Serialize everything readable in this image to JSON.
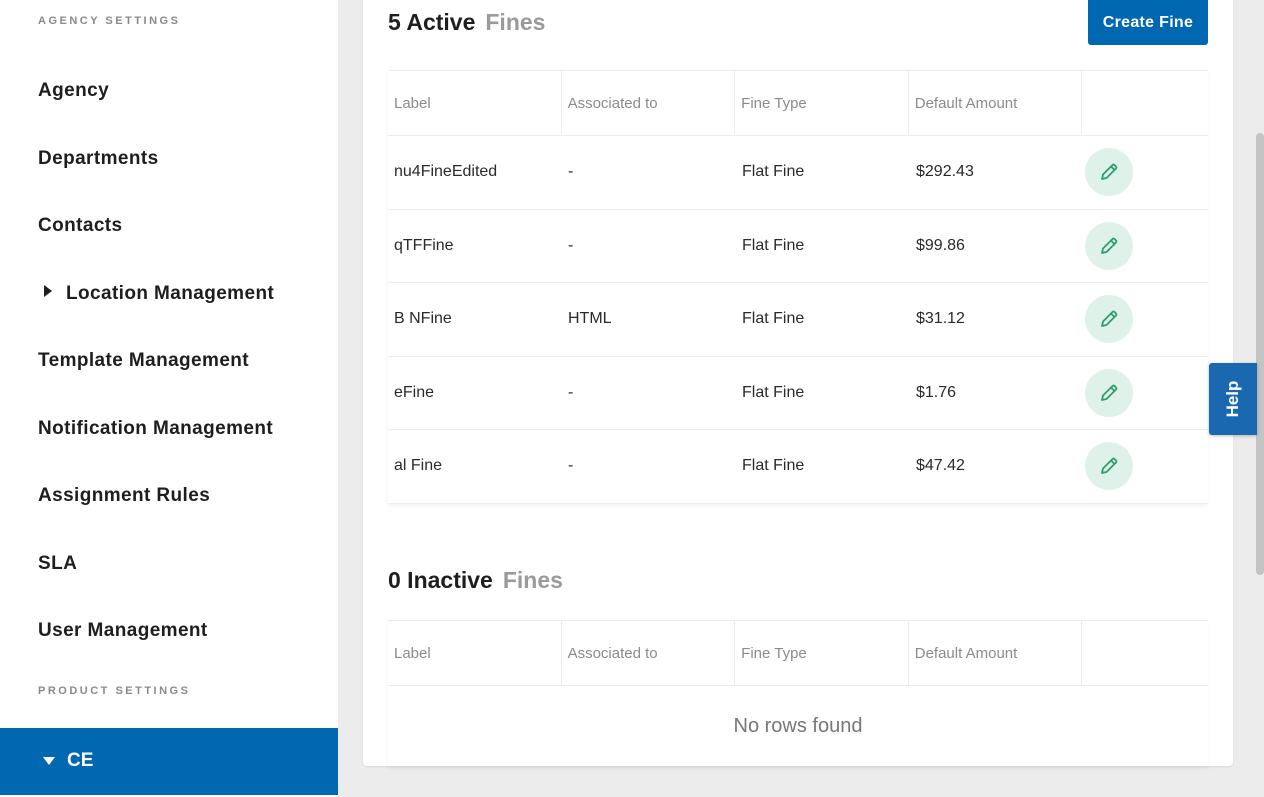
{
  "sidebar": {
    "agency_section_label": "AGENCY SETTINGS",
    "items": [
      {
        "label": "Agency"
      },
      {
        "label": "Departments"
      },
      {
        "label": "Contacts"
      },
      {
        "label": "Location Management",
        "collapsed": true
      },
      {
        "label": "Template Management"
      },
      {
        "label": "Notification Management"
      },
      {
        "label": "Assignment Rules"
      },
      {
        "label": "SLA"
      },
      {
        "label": "User Management"
      }
    ],
    "product_section_label": "PRODUCT SETTINGS",
    "active_item": {
      "label": "CE",
      "expanded": true
    }
  },
  "active": {
    "count": "5 Active",
    "noun": "Fines",
    "create_label": "Create Fine",
    "columns": [
      "Label",
      "Associated to",
      "Fine Type",
      "Default Amount"
    ],
    "rows": [
      {
        "label": "nu4FineEdited",
        "associated": "-",
        "type": "Flat Fine",
        "amount": "$292.43"
      },
      {
        "label": "qTFFine",
        "associated": "-",
        "type": "Flat Fine",
        "amount": "$99.86"
      },
      {
        "label": "B NFine",
        "associated": "HTML",
        "type": "Flat Fine",
        "amount": "$31.12"
      },
      {
        "label": "eFine",
        "associated": "-",
        "type": "Flat Fine",
        "amount": "$1.76"
      },
      {
        "label": "al Fine",
        "associated": "-",
        "type": "Flat Fine",
        "amount": "$47.42"
      }
    ]
  },
  "inactive": {
    "count": "0 Inactive",
    "noun": "Fines",
    "columns": [
      "Label",
      "Associated to",
      "Fine Type",
      "Default Amount"
    ],
    "empty_text": "No rows found"
  },
  "help": {
    "label": "Help"
  },
  "colors": {
    "accent": "#0067b1",
    "edit_bg": "#dff2ea",
    "edit_icon": "#2e9e6a"
  }
}
